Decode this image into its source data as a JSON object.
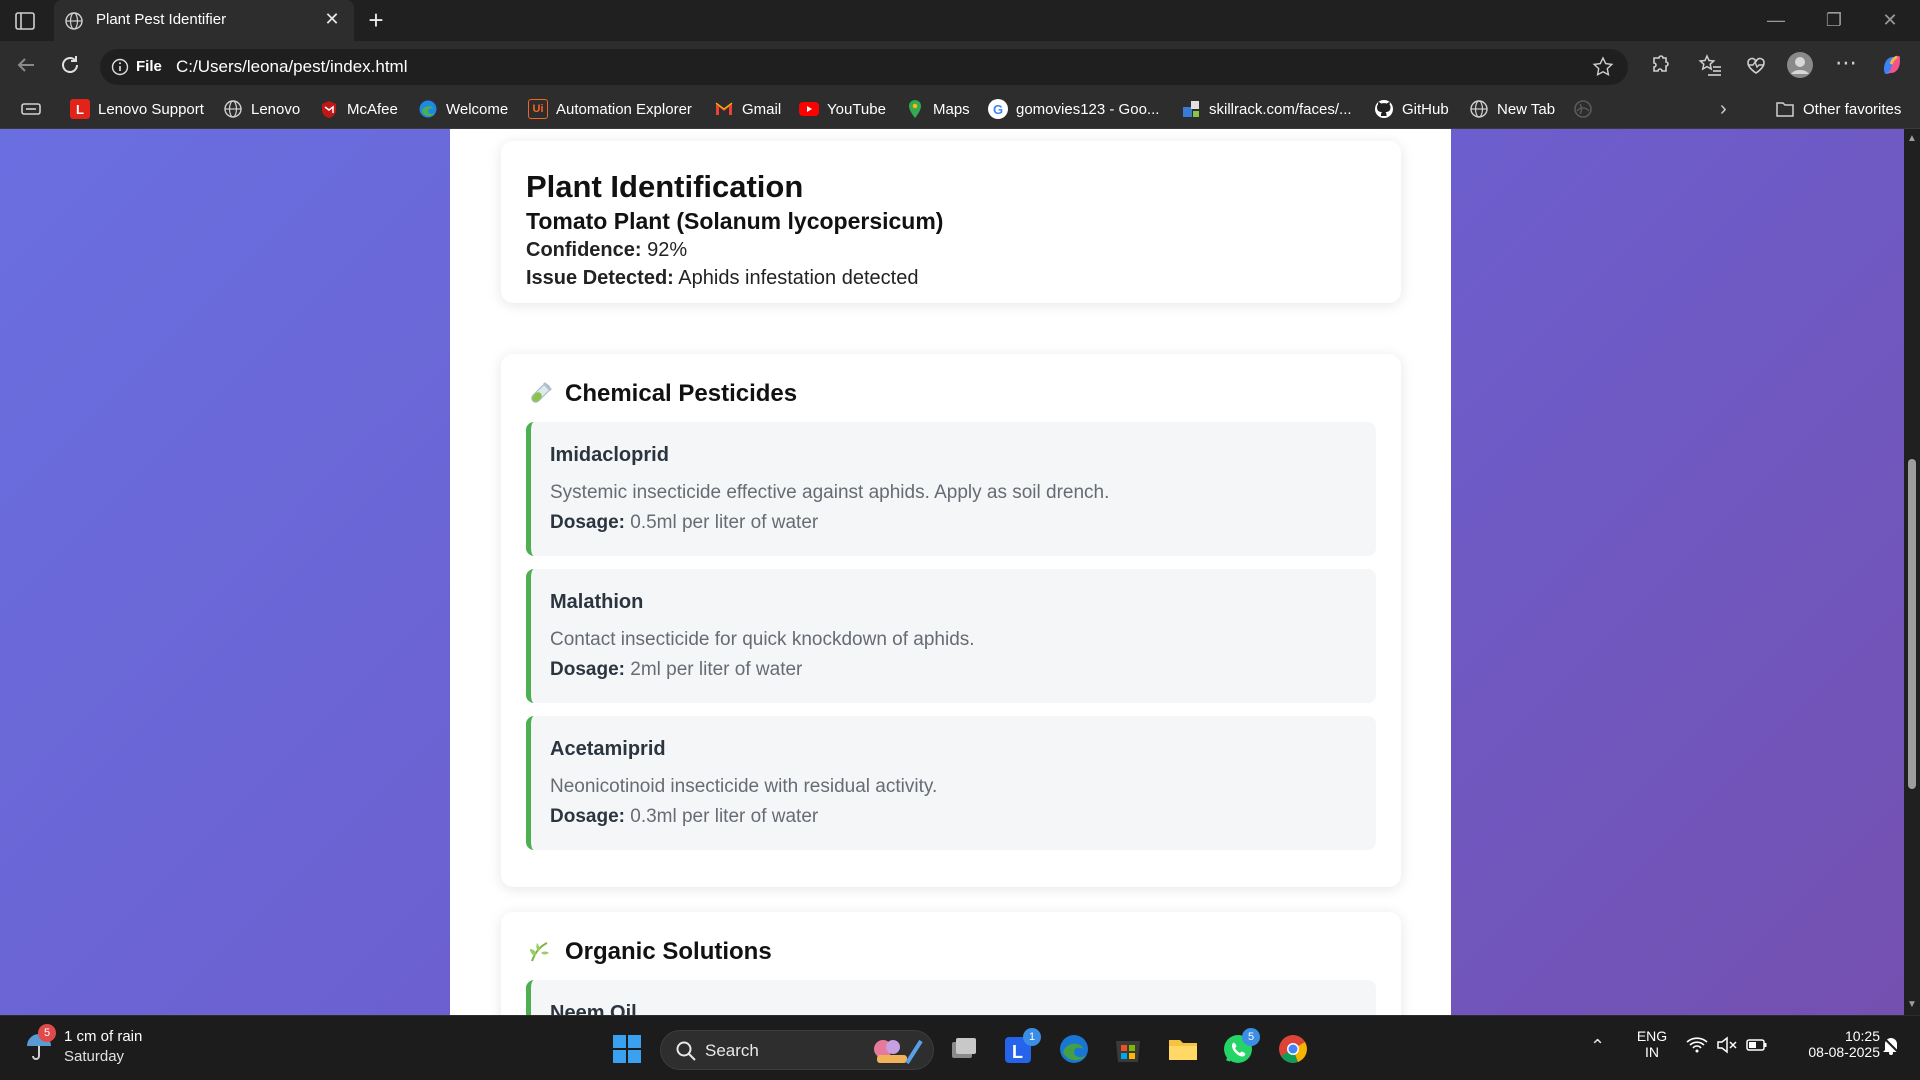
{
  "browser": {
    "tab_title": "Plant Pest Identifier",
    "scheme_label": "File",
    "url": "C:/Users/leona/pest/index.html"
  },
  "favorites": [
    {
      "label": "Lenovo Support",
      "icon": "lenovo-support-icon",
      "color": "#e2231a"
    },
    {
      "label": "Lenovo",
      "icon": "globe-icon",
      "color": "#444444"
    },
    {
      "label": "McAfee",
      "icon": "mcafee-icon",
      "color": "#c01818"
    },
    {
      "label": "Welcome",
      "icon": "edge-icon",
      "color": "#1e88e5"
    },
    {
      "label": "Automation Explorer",
      "icon": "uipath-icon",
      "color": "#f26522"
    },
    {
      "label": "Gmail",
      "icon": "gmail-icon",
      "color": "#ea4335"
    },
    {
      "label": "YouTube",
      "icon": "youtube-icon",
      "color": "#ff0000"
    },
    {
      "label": "Maps",
      "icon": "maps-icon",
      "color": "#34a853"
    },
    {
      "label": "gomovies123 - Goo...",
      "icon": "google-icon",
      "color": "#ffffff"
    },
    {
      "label": "skillrack.com/faces/...",
      "icon": "skillrack-icon",
      "color": "#3b7bd8"
    },
    {
      "label": "GitHub",
      "icon": "github-icon",
      "color": "#ffffff"
    },
    {
      "label": "New Tab",
      "icon": "globe-icon",
      "color": "#444444"
    }
  ],
  "other_favorites": "Other favorites",
  "identification": {
    "heading": "Plant Identification",
    "plant_name": "Tomato Plant (Solanum lycopersicum)",
    "confidence_label": "Confidence:",
    "confidence_value": "92%",
    "issue_label": "Issue Detected:",
    "issue_value": "Aphids infestation detected"
  },
  "chemical": {
    "title": "Chemical Pesticides",
    "items": [
      {
        "name": "Imidacloprid",
        "desc": "Systemic insecticide effective against aphids. Apply as soil drench.",
        "dosage_label": "Dosage:",
        "dosage": "0.5ml per liter of water"
      },
      {
        "name": "Malathion",
        "desc": "Contact insecticide for quick knockdown of aphids.",
        "dosage_label": "Dosage:",
        "dosage": "2ml per liter of water"
      },
      {
        "name": "Acetamiprid",
        "desc": "Neonicotinoid insecticide with residual activity.",
        "dosage_label": "Dosage:",
        "dosage": "0.3ml per liter of water"
      }
    ]
  },
  "organic": {
    "title": "Organic Solutions",
    "first_item": "Neem Oil"
  },
  "taskbar": {
    "weather_line1": "1 cm of rain",
    "weather_line2": "Saturday",
    "weather_badge": "5",
    "search_label": "Search",
    "lang_line1": "ENG",
    "lang_line2": "IN",
    "time": "10:25",
    "date": "08-08-2025",
    "teams_badge": "1",
    "whatsapp_badge": "5"
  },
  "colors": {
    "accent_green": "#4caf50",
    "bg_gradient_start": "#6a6fe0",
    "bg_gradient_end": "#7450b0"
  }
}
